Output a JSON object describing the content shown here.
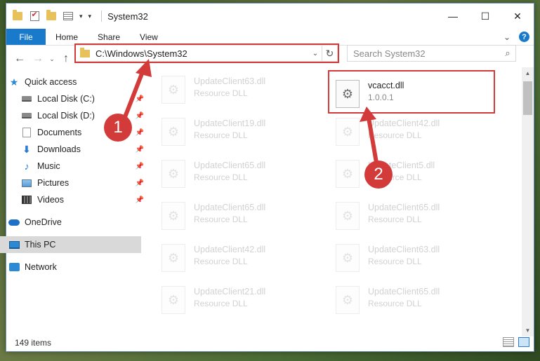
{
  "titlebar": {
    "title": "System32",
    "minimize": "—",
    "maximize": "☐",
    "close": "✕"
  },
  "ribbon": {
    "tabs": [
      "File",
      "Home",
      "Share",
      "View"
    ],
    "help": "?",
    "expand": "⌄"
  },
  "navbar": {
    "back": "←",
    "forward": "→",
    "recent": "⌄",
    "up": "↑",
    "address": "C:\\Windows\\System32",
    "address_dropdown": "⌄",
    "refresh": "↻",
    "search_placeholder": "Search System32",
    "search_icon": "⌕"
  },
  "sidebar": {
    "items": [
      {
        "label": "Quick access",
        "icon": "star-icon",
        "pinned": false
      },
      {
        "label": "Local Disk (C:)",
        "icon": "disk-icon",
        "pinned": true
      },
      {
        "label": "Local Disk (D:)",
        "icon": "disk-icon",
        "pinned": true
      },
      {
        "label": "Documents",
        "icon": "documents-icon",
        "pinned": true
      },
      {
        "label": "Downloads",
        "icon": "downloads-icon",
        "pinned": true
      },
      {
        "label": "Music",
        "icon": "music-icon",
        "pinned": true
      },
      {
        "label": "Pictures",
        "icon": "pictures-icon",
        "pinned": true
      },
      {
        "label": "Videos",
        "icon": "videos-icon",
        "pinned": true
      },
      {
        "label": "OneDrive",
        "icon": "onedrive-icon",
        "pinned": false
      },
      {
        "label": "This PC",
        "icon": "this-pc-icon",
        "pinned": false,
        "selected": true
      },
      {
        "label": "Network",
        "icon": "network-icon",
        "pinned": false
      }
    ],
    "pin_glyph": "📌"
  },
  "files": {
    "left": [
      {
        "name": "UpdateClient63.dll",
        "type": "Resource DLL"
      },
      {
        "name": "UpdateClient19.dll",
        "type": "Resource DLL"
      },
      {
        "name": "UpdateClient65.dll",
        "type": "Resource DLL"
      },
      {
        "name": "UpdateClient65.dll",
        "type": "Resource DLL"
      },
      {
        "name": "UpdateClient42.dll",
        "type": "Resource DLL"
      },
      {
        "name": "UpdateClient21.dll",
        "type": "Resource DLL"
      }
    ],
    "right": [
      {
        "name": "vcacct.dll",
        "type": "1.0.0.1",
        "highlighted": true
      },
      {
        "name": "UpdateClient42.dll",
        "type": "Resource DLL"
      },
      {
        "name": "UpdateClient5.dll",
        "type": "Resource DLL"
      },
      {
        "name": "UpdateClient65.dll",
        "type": "Resource DLL"
      },
      {
        "name": "UpdateClient63.dll",
        "type": "Resource DLL"
      },
      {
        "name": "UpdateClient65.dll",
        "type": "Resource DLL"
      }
    ]
  },
  "status": {
    "item_count": "149 items"
  },
  "annotations": {
    "step1": "1",
    "step2": "2",
    "color": "#d33a3a"
  },
  "colors": {
    "accent": "#1979ca",
    "annotation_red": "#d33a3a"
  }
}
